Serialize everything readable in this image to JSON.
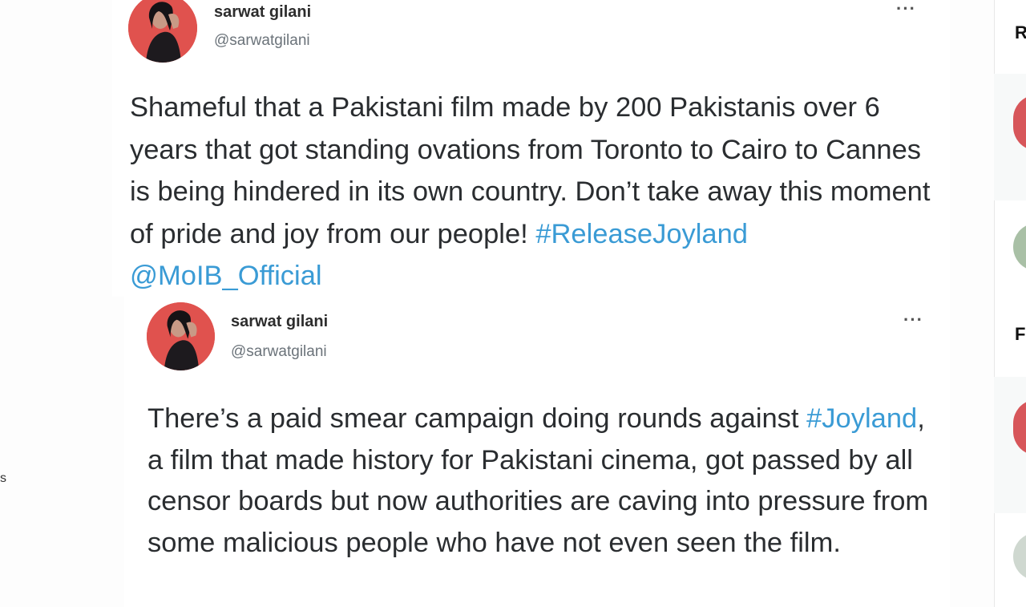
{
  "tweets": [
    {
      "author": {
        "name": "sarwat gilani",
        "handle": "@sarwatgilani"
      },
      "more": "···",
      "text": "Shameful that a Pakistani film made by 200 Pakistanis over 6 years that got standing ovations from Toronto to Cairo to Cannes is being hindered in its own country. Don’t take away this moment of pride and joy from our people! ",
      "hashtag": "#ReleaseJoyland",
      "mention": "@MoIB_Official"
    },
    {
      "author": {
        "name": "sarwat gilani",
        "handle": "@sarwatgilani"
      },
      "more": "···",
      "text_before": "There’s a paid smear campaign doing rounds against ",
      "hashtag": "#Joyland",
      "text_after": ", a film that made history for Pakistani cinema, got passed by all censor boards but now authorities are caving into pressure from some malicious people who have not even seen the film."
    }
  ],
  "right_column": {
    "heading_1": "R",
    "heading_2": "F"
  },
  "left_edge_glyph": "s",
  "colors": {
    "link": "#3a9bd5",
    "avatar_bg": "#e0524e",
    "text": "#2a2d30",
    "handle": "#6b737a"
  }
}
